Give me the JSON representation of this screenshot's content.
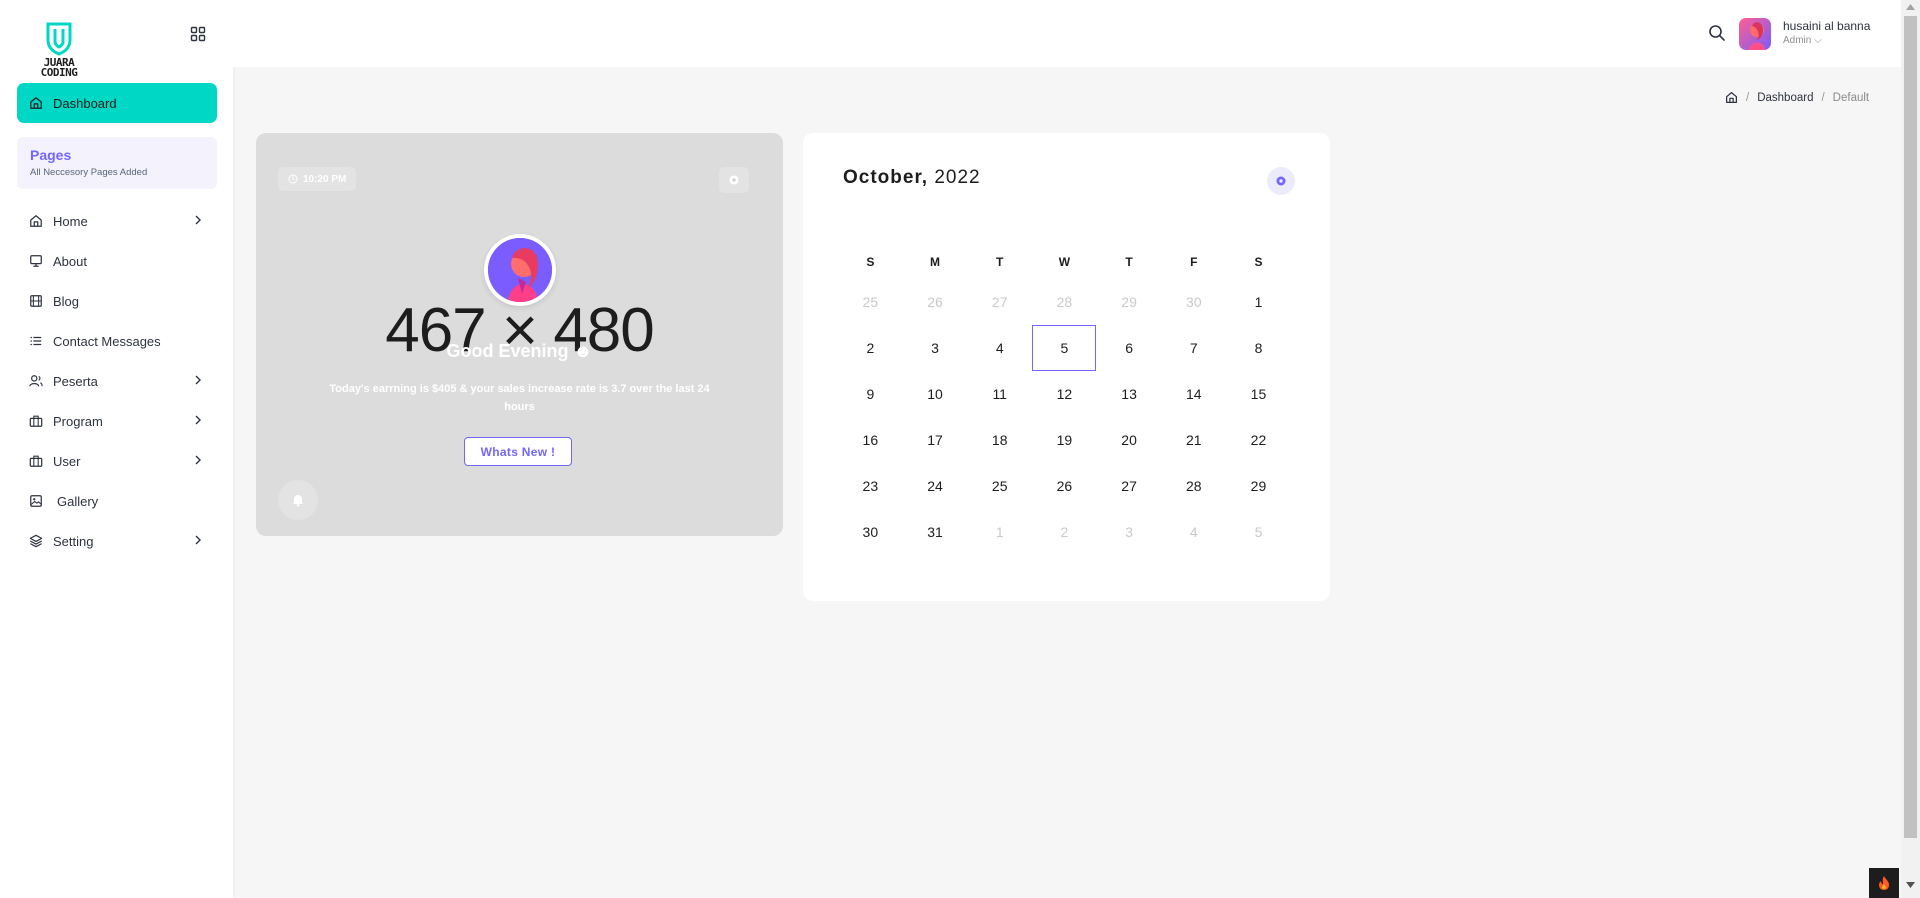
{
  "brand": {
    "logo_text_line1": "JUARA",
    "logo_text_line2": "CODING",
    "accent": "#00d7c4",
    "primary": "#7366ff"
  },
  "sidebar": {
    "active_item": "Dashboard",
    "pages_card": {
      "title": "Pages",
      "subtitle": "All Neccesory Pages Added"
    },
    "items": [
      {
        "label": "Home",
        "icon": "home-icon",
        "has_submenu": true
      },
      {
        "label": "About",
        "icon": "monitor-icon",
        "has_submenu": false
      },
      {
        "label": "Blog",
        "icon": "film-icon",
        "has_submenu": false
      },
      {
        "label": "Contact Messages",
        "icon": "list-icon",
        "has_submenu": false
      },
      {
        "label": "Peserta",
        "icon": "users-icon",
        "has_submenu": true
      },
      {
        "label": "Program",
        "icon": "briefcase-icon",
        "has_submenu": true
      },
      {
        "label": "User",
        "icon": "briefcase-icon",
        "has_submenu": true
      },
      {
        "label": "Gallery",
        "icon": "image-icon",
        "has_submenu": false
      },
      {
        "label": "Setting",
        "icon": "layers-icon",
        "has_submenu": true
      }
    ]
  },
  "header": {
    "user_name": "husaini al banna",
    "user_role": "Admin",
    "user_role_chevron": "⌵"
  },
  "breadcrumb": {
    "items": [
      "Dashboard",
      "Default"
    ]
  },
  "welcome_card": {
    "time": "10:20 PM",
    "placeholder_dimensions": "467 × 480",
    "greeting": "Good Evening",
    "greeting_emoji": "☻",
    "message": "Today's earrning is $405 & your sales increase rate is 3.7 over the last 24 hours",
    "button_label": "Whats New !"
  },
  "calendar": {
    "month": "October,",
    "year": "2022",
    "weekdays": [
      "S",
      "M",
      "T",
      "W",
      "T",
      "F",
      "S"
    ],
    "weeks": [
      [
        {
          "d": "25",
          "m": true
        },
        {
          "d": "26",
          "m": true
        },
        {
          "d": "27",
          "m": true
        },
        {
          "d": "28",
          "m": true
        },
        {
          "d": "29",
          "m": true
        },
        {
          "d": "30",
          "m": true
        },
        {
          "d": "1"
        }
      ],
      [
        {
          "d": "2"
        },
        {
          "d": "3"
        },
        {
          "d": "4"
        },
        {
          "d": "5",
          "sel": true
        },
        {
          "d": "6"
        },
        {
          "d": "7"
        },
        {
          "d": "8"
        }
      ],
      [
        {
          "d": "9"
        },
        {
          "d": "10"
        },
        {
          "d": "11"
        },
        {
          "d": "12"
        },
        {
          "d": "13"
        },
        {
          "d": "14"
        },
        {
          "d": "15"
        }
      ],
      [
        {
          "d": "16"
        },
        {
          "d": "17"
        },
        {
          "d": "18"
        },
        {
          "d": "19"
        },
        {
          "d": "20"
        },
        {
          "d": "21"
        },
        {
          "d": "22"
        }
      ],
      [
        {
          "d": "23"
        },
        {
          "d": "24"
        },
        {
          "d": "25"
        },
        {
          "d": "26"
        },
        {
          "d": "27"
        },
        {
          "d": "28"
        },
        {
          "d": "29"
        }
      ],
      [
        {
          "d": "30"
        },
        {
          "d": "31"
        },
        {
          "d": "1",
          "m": true
        },
        {
          "d": "2",
          "m": true
        },
        {
          "d": "3",
          "m": true
        },
        {
          "d": "4",
          "m": true
        },
        {
          "d": "5",
          "m": true
        }
      ]
    ]
  }
}
